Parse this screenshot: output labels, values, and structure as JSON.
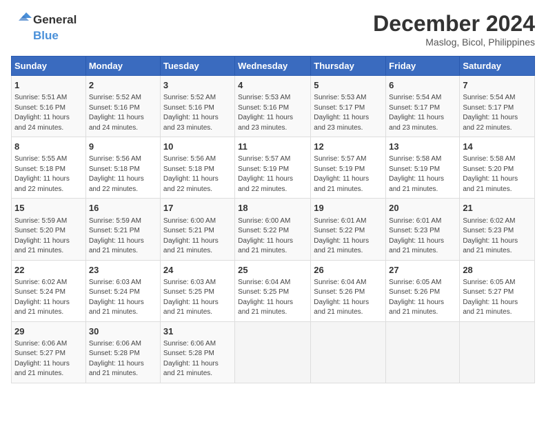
{
  "logo": {
    "line1": "General",
    "line2": "Blue"
  },
  "title": "December 2024",
  "subtitle": "Maslog, Bicol, Philippines",
  "weekdays": [
    "Sunday",
    "Monday",
    "Tuesday",
    "Wednesday",
    "Thursday",
    "Friday",
    "Saturday"
  ],
  "weeks": [
    [
      {
        "day": "1",
        "info": "Sunrise: 5:51 AM\nSunset: 5:16 PM\nDaylight: 11 hours\nand 24 minutes."
      },
      {
        "day": "2",
        "info": "Sunrise: 5:52 AM\nSunset: 5:16 PM\nDaylight: 11 hours\nand 24 minutes."
      },
      {
        "day": "3",
        "info": "Sunrise: 5:52 AM\nSunset: 5:16 PM\nDaylight: 11 hours\nand 23 minutes."
      },
      {
        "day": "4",
        "info": "Sunrise: 5:53 AM\nSunset: 5:16 PM\nDaylight: 11 hours\nand 23 minutes."
      },
      {
        "day": "5",
        "info": "Sunrise: 5:53 AM\nSunset: 5:17 PM\nDaylight: 11 hours\nand 23 minutes."
      },
      {
        "day": "6",
        "info": "Sunrise: 5:54 AM\nSunset: 5:17 PM\nDaylight: 11 hours\nand 23 minutes."
      },
      {
        "day": "7",
        "info": "Sunrise: 5:54 AM\nSunset: 5:17 PM\nDaylight: 11 hours\nand 22 minutes."
      }
    ],
    [
      {
        "day": "8",
        "info": "Sunrise: 5:55 AM\nSunset: 5:18 PM\nDaylight: 11 hours\nand 22 minutes."
      },
      {
        "day": "9",
        "info": "Sunrise: 5:56 AM\nSunset: 5:18 PM\nDaylight: 11 hours\nand 22 minutes."
      },
      {
        "day": "10",
        "info": "Sunrise: 5:56 AM\nSunset: 5:18 PM\nDaylight: 11 hours\nand 22 minutes."
      },
      {
        "day": "11",
        "info": "Sunrise: 5:57 AM\nSunset: 5:19 PM\nDaylight: 11 hours\nand 22 minutes."
      },
      {
        "day": "12",
        "info": "Sunrise: 5:57 AM\nSunset: 5:19 PM\nDaylight: 11 hours\nand 21 minutes."
      },
      {
        "day": "13",
        "info": "Sunrise: 5:58 AM\nSunset: 5:19 PM\nDaylight: 11 hours\nand 21 minutes."
      },
      {
        "day": "14",
        "info": "Sunrise: 5:58 AM\nSunset: 5:20 PM\nDaylight: 11 hours\nand 21 minutes."
      }
    ],
    [
      {
        "day": "15",
        "info": "Sunrise: 5:59 AM\nSunset: 5:20 PM\nDaylight: 11 hours\nand 21 minutes."
      },
      {
        "day": "16",
        "info": "Sunrise: 5:59 AM\nSunset: 5:21 PM\nDaylight: 11 hours\nand 21 minutes."
      },
      {
        "day": "17",
        "info": "Sunrise: 6:00 AM\nSunset: 5:21 PM\nDaylight: 11 hours\nand 21 minutes."
      },
      {
        "day": "18",
        "info": "Sunrise: 6:00 AM\nSunset: 5:22 PM\nDaylight: 11 hours\nand 21 minutes."
      },
      {
        "day": "19",
        "info": "Sunrise: 6:01 AM\nSunset: 5:22 PM\nDaylight: 11 hours\nand 21 minutes."
      },
      {
        "day": "20",
        "info": "Sunrise: 6:01 AM\nSunset: 5:23 PM\nDaylight: 11 hours\nand 21 minutes."
      },
      {
        "day": "21",
        "info": "Sunrise: 6:02 AM\nSunset: 5:23 PM\nDaylight: 11 hours\nand 21 minutes."
      }
    ],
    [
      {
        "day": "22",
        "info": "Sunrise: 6:02 AM\nSunset: 5:24 PM\nDaylight: 11 hours\nand 21 minutes."
      },
      {
        "day": "23",
        "info": "Sunrise: 6:03 AM\nSunset: 5:24 PM\nDaylight: 11 hours\nand 21 minutes."
      },
      {
        "day": "24",
        "info": "Sunrise: 6:03 AM\nSunset: 5:25 PM\nDaylight: 11 hours\nand 21 minutes."
      },
      {
        "day": "25",
        "info": "Sunrise: 6:04 AM\nSunset: 5:25 PM\nDaylight: 11 hours\nand 21 minutes."
      },
      {
        "day": "26",
        "info": "Sunrise: 6:04 AM\nSunset: 5:26 PM\nDaylight: 11 hours\nand 21 minutes."
      },
      {
        "day": "27",
        "info": "Sunrise: 6:05 AM\nSunset: 5:26 PM\nDaylight: 11 hours\nand 21 minutes."
      },
      {
        "day": "28",
        "info": "Sunrise: 6:05 AM\nSunset: 5:27 PM\nDaylight: 11 hours\nand 21 minutes."
      }
    ],
    [
      {
        "day": "29",
        "info": "Sunrise: 6:06 AM\nSunset: 5:27 PM\nDaylight: 11 hours\nand 21 minutes."
      },
      {
        "day": "30",
        "info": "Sunrise: 6:06 AM\nSunset: 5:28 PM\nDaylight: 11 hours\nand 21 minutes."
      },
      {
        "day": "31",
        "info": "Sunrise: 6:06 AM\nSunset: 5:28 PM\nDaylight: 11 hours\nand 21 minutes."
      },
      null,
      null,
      null,
      null
    ]
  ]
}
